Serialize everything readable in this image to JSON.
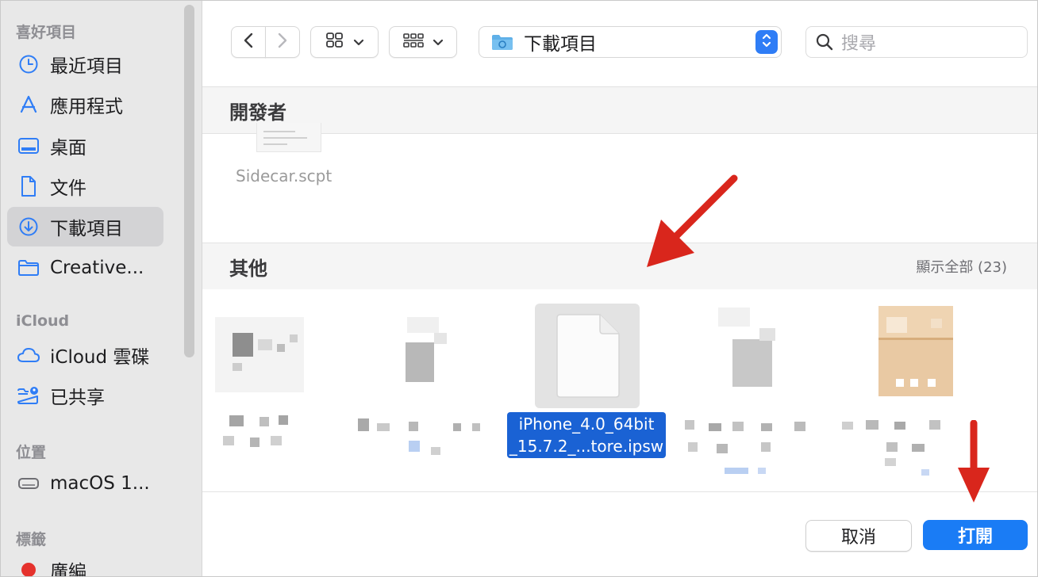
{
  "sidebar": {
    "favorites_title": "喜好項目",
    "favorites": [
      {
        "label": "最近項目",
        "icon": "clock-icon"
      },
      {
        "label": "應用程式",
        "icon": "app-store-icon"
      },
      {
        "label": "桌面",
        "icon": "desktop-icon"
      },
      {
        "label": "文件",
        "icon": "document-icon"
      },
      {
        "label": "下載項目",
        "icon": "download-icon"
      },
      {
        "label": "Creative...",
        "icon": "folder-icon"
      }
    ],
    "icloud_title": "iCloud",
    "icloud": [
      {
        "label": "iCloud 雲碟",
        "icon": "cloud-icon"
      },
      {
        "label": "已共享",
        "icon": "shared-folder-icon"
      }
    ],
    "locations_title": "位置",
    "locations": [
      {
        "label": "macOS 1...",
        "icon": "disk-icon"
      }
    ],
    "tags_title": "標籤",
    "tags": [
      {
        "label": "廣編",
        "icon": "red-tag-dot",
        "color": "#e5322d"
      }
    ]
  },
  "toolbar": {
    "current_folder": "下載項目",
    "search_placeholder": "搜尋"
  },
  "content": {
    "group1_title": "開發者",
    "group1_file": "Sidecar.scpt",
    "group2_title": "其他",
    "show_all": "顯示全部 (23)",
    "selected_file_line1": "iPhone_4.0_64bit",
    "selected_file_line2": "_15.7.2_...tore.ipsw"
  },
  "buttons": {
    "cancel": "取消",
    "open": "打開"
  },
  "colors": {
    "accent": "#1a7cf5",
    "selection": "#1a62d4",
    "annotation_arrow": "#d9261c"
  }
}
